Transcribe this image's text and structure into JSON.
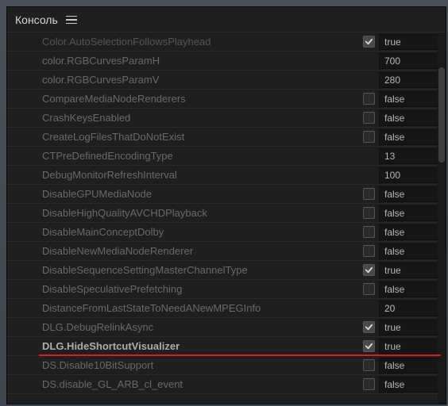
{
  "header": {
    "title": "Консоль"
  },
  "rows": [
    {
      "label": "Color.AutoSelectionFollowsPlayhead",
      "hasCheckbox": true,
      "checked": true,
      "value": "true",
      "muted": true,
      "highlight": false
    },
    {
      "label": "color.RGBCurvesParamH",
      "hasCheckbox": false,
      "checked": false,
      "value": "700",
      "muted": false,
      "highlight": false
    },
    {
      "label": "color.RGBCurvesParamV",
      "hasCheckbox": false,
      "checked": false,
      "value": "280",
      "muted": false,
      "highlight": false
    },
    {
      "label": "CompareMediaNodeRenderers",
      "hasCheckbox": true,
      "checked": false,
      "value": "false",
      "muted": false,
      "highlight": false
    },
    {
      "label": "CrashKeysEnabled",
      "hasCheckbox": true,
      "checked": false,
      "value": "false",
      "muted": false,
      "highlight": false
    },
    {
      "label": "CreateLogFilesThatDoNotExist",
      "hasCheckbox": true,
      "checked": false,
      "value": "false",
      "muted": false,
      "highlight": false
    },
    {
      "label": "CTPreDefinedEncodingType",
      "hasCheckbox": false,
      "checked": false,
      "value": "13",
      "muted": false,
      "highlight": false
    },
    {
      "label": "DebugMonitorRefreshInterval",
      "hasCheckbox": false,
      "checked": false,
      "value": "100",
      "muted": false,
      "highlight": false
    },
    {
      "label": "DisableGPUMediaNode",
      "hasCheckbox": true,
      "checked": false,
      "value": "false",
      "muted": false,
      "highlight": false
    },
    {
      "label": "DisableHighQualityAVCHDPlayback",
      "hasCheckbox": true,
      "checked": false,
      "value": "false",
      "muted": false,
      "highlight": false
    },
    {
      "label": "DisableMainConceptDolby",
      "hasCheckbox": true,
      "checked": false,
      "value": "false",
      "muted": false,
      "highlight": false
    },
    {
      "label": "DisableNewMediaNodeRenderer",
      "hasCheckbox": true,
      "checked": false,
      "value": "false",
      "muted": false,
      "highlight": false
    },
    {
      "label": "DisableSequenceSettingMasterChannelType",
      "hasCheckbox": true,
      "checked": true,
      "value": "true",
      "muted": false,
      "highlight": false
    },
    {
      "label": "DisableSpeculativePrefetching",
      "hasCheckbox": true,
      "checked": false,
      "value": "false",
      "muted": false,
      "highlight": false
    },
    {
      "label": "DistanceFromLastStateToNeedANewMPEGInfo",
      "hasCheckbox": false,
      "checked": false,
      "value": "20",
      "muted": false,
      "highlight": false
    },
    {
      "label": "DLG.DebugRelinkAsync",
      "hasCheckbox": true,
      "checked": true,
      "value": "true",
      "muted": false,
      "highlight": false
    },
    {
      "label": "DLG.HideShortcutVisualizer",
      "hasCheckbox": true,
      "checked": true,
      "value": "true",
      "muted": false,
      "highlight": true
    },
    {
      "label": "DS.Disable10BitSupport",
      "hasCheckbox": true,
      "checked": false,
      "value": "false",
      "muted": false,
      "highlight": false
    },
    {
      "label": "DS.disable_GL_ARB_cl_event",
      "hasCheckbox": true,
      "checked": false,
      "value": "false",
      "muted": false,
      "highlight": false
    }
  ]
}
